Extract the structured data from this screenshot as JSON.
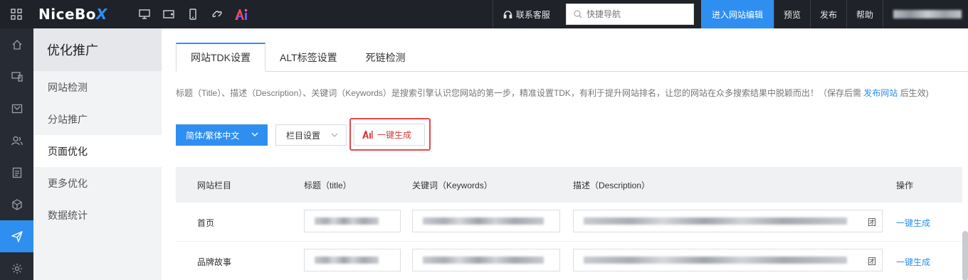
{
  "topbar": {
    "logo_main": "NiceBo",
    "logo_x": "X",
    "service_label": "联系客服",
    "search_placeholder": "快捷导航",
    "enter_edit_label": "进入网站编辑",
    "preview_label": "预览",
    "publish_label": "发布",
    "help_label": "帮助",
    "device_icons": [
      "monitor-icon",
      "tablet-icon",
      "phone-icon",
      "link-icon",
      "ai-icon"
    ]
  },
  "rail": {
    "icons": [
      "home-icon",
      "devices-icon",
      "mail-icon",
      "users-icon",
      "document-icon",
      "cube-icon",
      "send-icon",
      "settings-icon"
    ],
    "active_index": 6
  },
  "submenu": {
    "title": "优化推广",
    "items": [
      {
        "label": "网站检测"
      },
      {
        "label": "分站推广"
      },
      {
        "label": "页面优化"
      },
      {
        "label": "更多优化"
      },
      {
        "label": "数据统计"
      }
    ],
    "active_index": 2
  },
  "tabs": [
    {
      "label": "网站TDK设置"
    },
    {
      "label": "ALT标签设置"
    },
    {
      "label": "死链检测"
    }
  ],
  "hint": {
    "text": "标题（Title）、描述（Description）、关键词（Keywords）是搜索引擎认识您网站的第一步，精准设置TDK，有利于提升网站排名，让您的网站在众多搜索结果中脱颖而出！（保存后需 ",
    "link": "发布网站",
    "suffix": " 后生效)"
  },
  "toolbar": {
    "lang_label": "简体/繁体中文",
    "column_label": "栏目设置",
    "generate_label": "一键生成"
  },
  "table": {
    "headers": [
      "网站栏目",
      "标题（title）",
      "关键词（Keywords）",
      "描述（Description）",
      "操作"
    ],
    "rows": [
      {
        "name": "首页",
        "desc_tail": "团",
        "op": "一键生成"
      },
      {
        "name": "品牌故事",
        "desc_tail": "团",
        "op": "一键生成"
      }
    ]
  },
  "colors": {
    "accent": "#2f8ff0",
    "topbar_bg": "#1f2229",
    "rail_bg": "#272b33",
    "highlight_red": "#e8474d"
  }
}
